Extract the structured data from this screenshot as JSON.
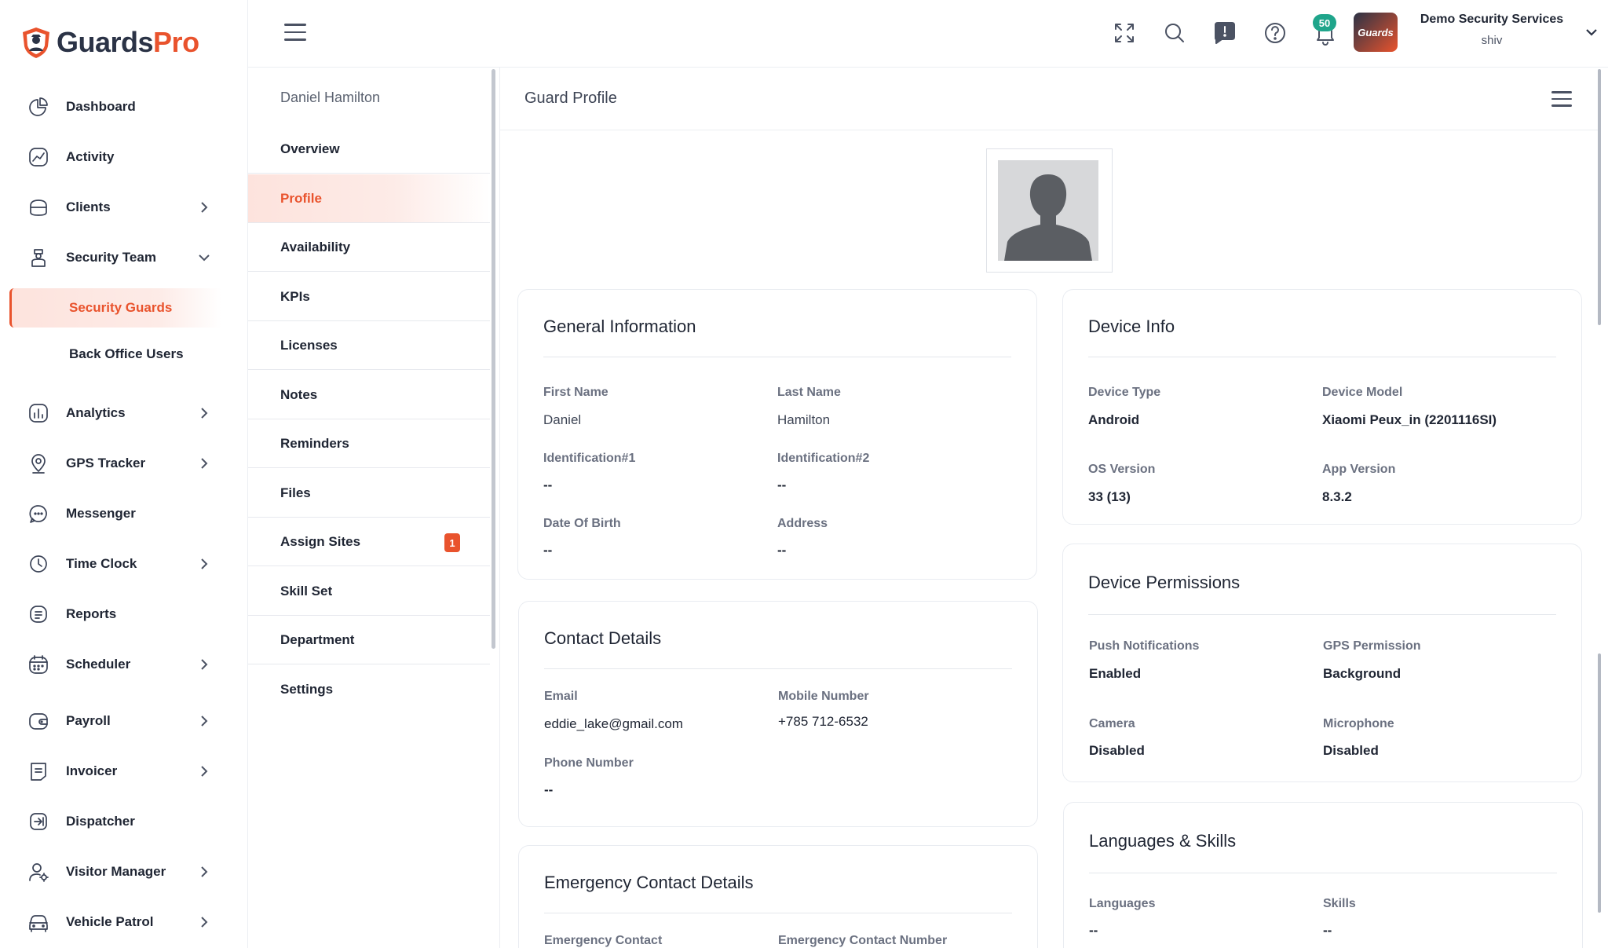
{
  "logo": {
    "part1": "Guards",
    "part2": "Pro"
  },
  "sidebar": {
    "items": [
      {
        "label": "Dashboard"
      },
      {
        "label": "Activity"
      },
      {
        "label": "Clients"
      },
      {
        "label": "Security Team"
      },
      {
        "label": "Security Guards"
      },
      {
        "label": "Back Office Users"
      },
      {
        "label": "Analytics"
      },
      {
        "label": "GPS Tracker"
      },
      {
        "label": "Messenger"
      },
      {
        "label": "Time Clock"
      },
      {
        "label": "Reports"
      },
      {
        "label": "Scheduler"
      },
      {
        "label": "Payroll"
      },
      {
        "label": "Invoicer"
      },
      {
        "label": "Dispatcher"
      },
      {
        "label": "Visitor Manager"
      },
      {
        "label": "Vehicle Patrol"
      }
    ]
  },
  "header": {
    "notification_count": "50",
    "org_name": "Demo Security Services",
    "user_name": "shiv"
  },
  "subnav": {
    "title": "Daniel Hamilton",
    "items": [
      {
        "label": "Overview"
      },
      {
        "label": "Profile"
      },
      {
        "label": "Availability"
      },
      {
        "label": "KPIs"
      },
      {
        "label": "Licenses"
      },
      {
        "label": "Notes"
      },
      {
        "label": "Reminders"
      },
      {
        "label": "Files"
      },
      {
        "label": "Assign Sites",
        "badge": "1"
      },
      {
        "label": "Skill Set"
      },
      {
        "label": "Department"
      },
      {
        "label": "Settings"
      }
    ]
  },
  "main": {
    "title": "Guard Profile",
    "general": {
      "title": "General Information",
      "first_name_label": "First Name",
      "first_name": "Daniel",
      "last_name_label": "Last Name",
      "last_name": "Hamilton",
      "id1_label": "Identification#1",
      "id1": "--",
      "id2_label": "Identification#2",
      "id2": "--",
      "dob_label": "Date Of Birth",
      "dob": "--",
      "address_label": "Address",
      "address": "--"
    },
    "contact": {
      "title": "Contact Details",
      "email_label": "Email",
      "email": "eddie_lake@gmail.com",
      "mobile_label": "Mobile Number",
      "mobile": "+785 712-6532",
      "phone_label": "Phone Number",
      "phone": "--"
    },
    "emergency": {
      "title": "Emergency Contact Details",
      "contact_label": "Emergency Contact",
      "number_label": "Emergency Contact Number"
    },
    "device": {
      "title": "Device Info",
      "type_label": "Device Type",
      "type": "Android",
      "model_label": "Device Model",
      "model": "Xiaomi Peux_in (2201116SI)",
      "os_label": "OS Version",
      "os": "33 (13)",
      "app_label": "App Version",
      "app": "8.3.2"
    },
    "permissions": {
      "title": "Device Permissions",
      "push_label": "Push Notifications",
      "push": "Enabled",
      "gps_label": "GPS Permission",
      "gps": "Background",
      "camera_label": "Camera",
      "camera": "Disabled",
      "mic_label": "Microphone",
      "mic": "Disabled"
    },
    "languages": {
      "title": "Languages & Skills",
      "languages_label": "Languages",
      "languages": "--",
      "skills_label": "Skills",
      "skills": "--"
    }
  },
  "colors": {
    "accent": "#e9532d",
    "badge": "#1fa58b",
    "text": "#1f2533"
  }
}
